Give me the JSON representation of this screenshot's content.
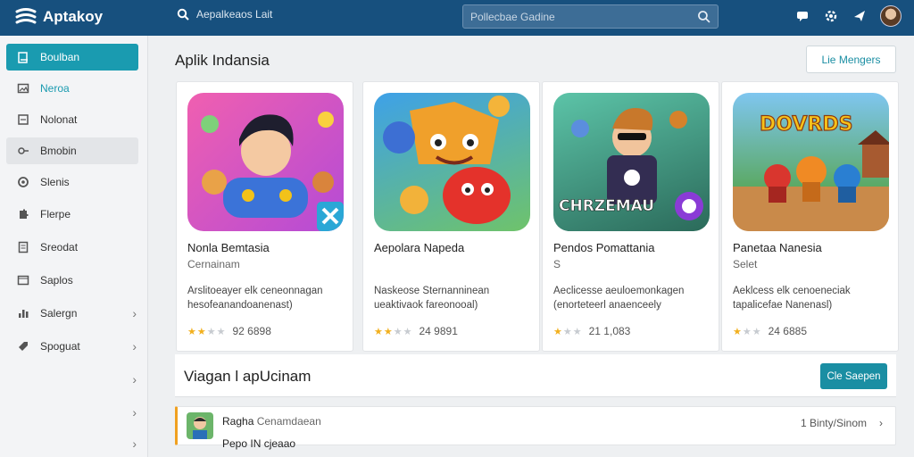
{
  "app": {
    "name": "Aptakoy"
  },
  "header": {
    "search_left_text": "Aepalkeaos Lait",
    "search_placeholder": "Pollecbae Gadine",
    "icons": [
      "chat-icon",
      "settings-icon",
      "send-icon",
      "avatar"
    ]
  },
  "sidebar": {
    "items": [
      {
        "label": "Boulban",
        "icon": "edit-icon",
        "state": "active"
      },
      {
        "label": "Neroa",
        "icon": "image-icon",
        "state": "teal"
      },
      {
        "label": "Nolonat",
        "icon": "list-icon"
      },
      {
        "label": "Bmobin",
        "icon": "link-icon",
        "state": "hover"
      },
      {
        "label": "Slenis",
        "icon": "circle-icon"
      },
      {
        "label": "Flerpe",
        "icon": "puzzle-icon"
      },
      {
        "label": "Sreodat",
        "icon": "document-icon"
      },
      {
        "label": "Saplos",
        "icon": "window-icon"
      },
      {
        "label": "Salergn",
        "icon": "chart-icon",
        "chevron": true
      },
      {
        "label": "Spoguat",
        "icon": "tag-icon",
        "chevron": true
      },
      {
        "label": "",
        "chevron": true
      },
      {
        "label": "",
        "chevron": true
      },
      {
        "label": "",
        "chevron": true
      }
    ]
  },
  "main": {
    "section1_title": "Aplik Indansia",
    "section1_button": "Lie Mengers",
    "cards": [
      {
        "title": "Nonla Bemtasia",
        "subtitle": "Cernainam",
        "desc": "Arslitoeayer elk ceneonnagan hesofeanandoanenast)",
        "rating_value": 2,
        "rating_text": "92 6898"
      },
      {
        "title": "Aepolara Napeda",
        "subtitle": "",
        "desc": "Naskeose Sternanninean ueaktivaok fareonooal)",
        "rating_value": 2,
        "rating_text": "24 9891"
      },
      {
        "title": "Pendos Pomattania",
        "subtitle": "S",
        "desc": "Aeclicesse aeuloemonkagen (enorteteerl anaenceely",
        "rating_value": 1,
        "rating_text": "21 1,083"
      },
      {
        "title": "Panetaa Nanesia",
        "subtitle": "Selet",
        "desc": "Aeklcess elk cenoeneciak tapalicefae Nanenasl)",
        "rating_value": 1,
        "rating_text": "24 6885"
      }
    ],
    "card_art_text": {
      "card3": "CHRZEMAU",
      "card4": "DOVRDS"
    },
    "section2_title": "Viagan l apUcinam",
    "section2_button": "Cle Saepen",
    "list_row": {
      "name": "Ragha",
      "name_muted": "Cenamdaean",
      "subtitle": "Pepo IN cjeaao",
      "right_text": "1 Binty/Sinom"
    }
  }
}
